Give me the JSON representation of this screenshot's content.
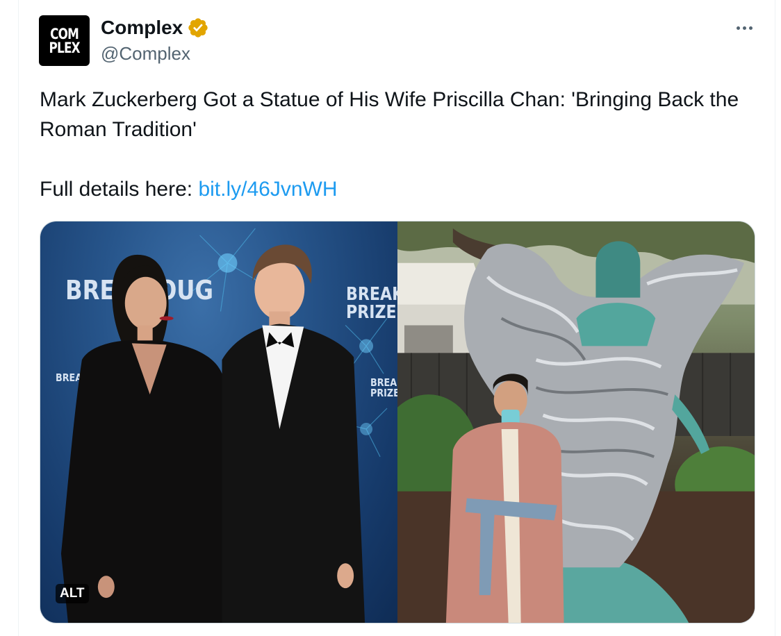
{
  "tweet": {
    "author": {
      "display_name": "Complex",
      "handle": "@Complex",
      "avatar_text": [
        "COM",
        "PLEX"
      ],
      "verified": true,
      "verified_color": "#f4b400"
    },
    "more_icon": "more-horizontal-icon",
    "text_line1": "Mark Zuckerberg Got a Statue of His Wife Priscilla Chan: 'Bringing Back the Roman Tradition'",
    "text_prefix": "Full details here: ",
    "link_text": "bit.ly/46JvnWH",
    "link_color": "#1d9bf0",
    "media": {
      "left_photo": {
        "backdrop_text": [
          "BREAK  OUG",
          "BREAK PRIZE",
          "BREA PRI",
          "BREAI PRIZE"
        ],
        "alt_label": "ALT"
      },
      "right_photo": {}
    }
  }
}
